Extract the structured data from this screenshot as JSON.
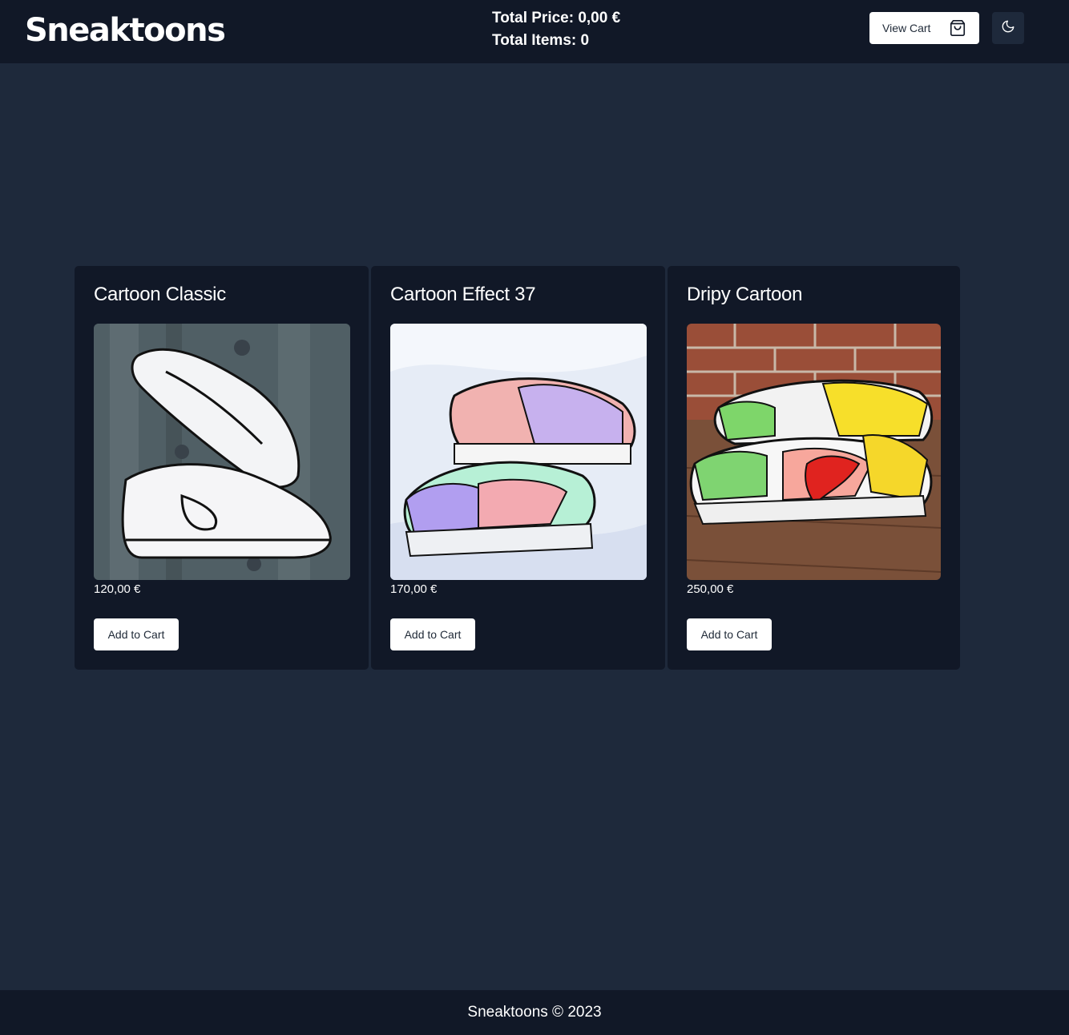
{
  "header": {
    "brand": "Sneaktoons",
    "total_price": "Total Price: 0,00 €",
    "total_items": "Total Items: 0",
    "view_cart_label": "View Cart",
    "cart_icon": "shopping-bag-icon",
    "theme_icon": "moon-icon"
  },
  "products": [
    {
      "title": "Cartoon Classic",
      "price": "120,00 €",
      "button": "Add to Cart",
      "image": "white cartoon-outlined sneakers on metal grate"
    },
    {
      "title": "Cartoon Effect 37",
      "price": "170,00 €",
      "button": "Add to Cart",
      "image": "pastel painted cartoon sneakers on white fabric"
    },
    {
      "title": "Dripy Cartoon",
      "price": "250,00 €",
      "button": "Add to Cart",
      "image": "colorful dripping-paint cartoon sneakers on wood deck"
    }
  ],
  "footer": {
    "text": "Sneaktoons © 2023"
  },
  "colors": {
    "page_bg": "#1e293b",
    "header_bg": "#111827",
    "card_bg": "#111827",
    "button_bg": "#ffffff"
  }
}
